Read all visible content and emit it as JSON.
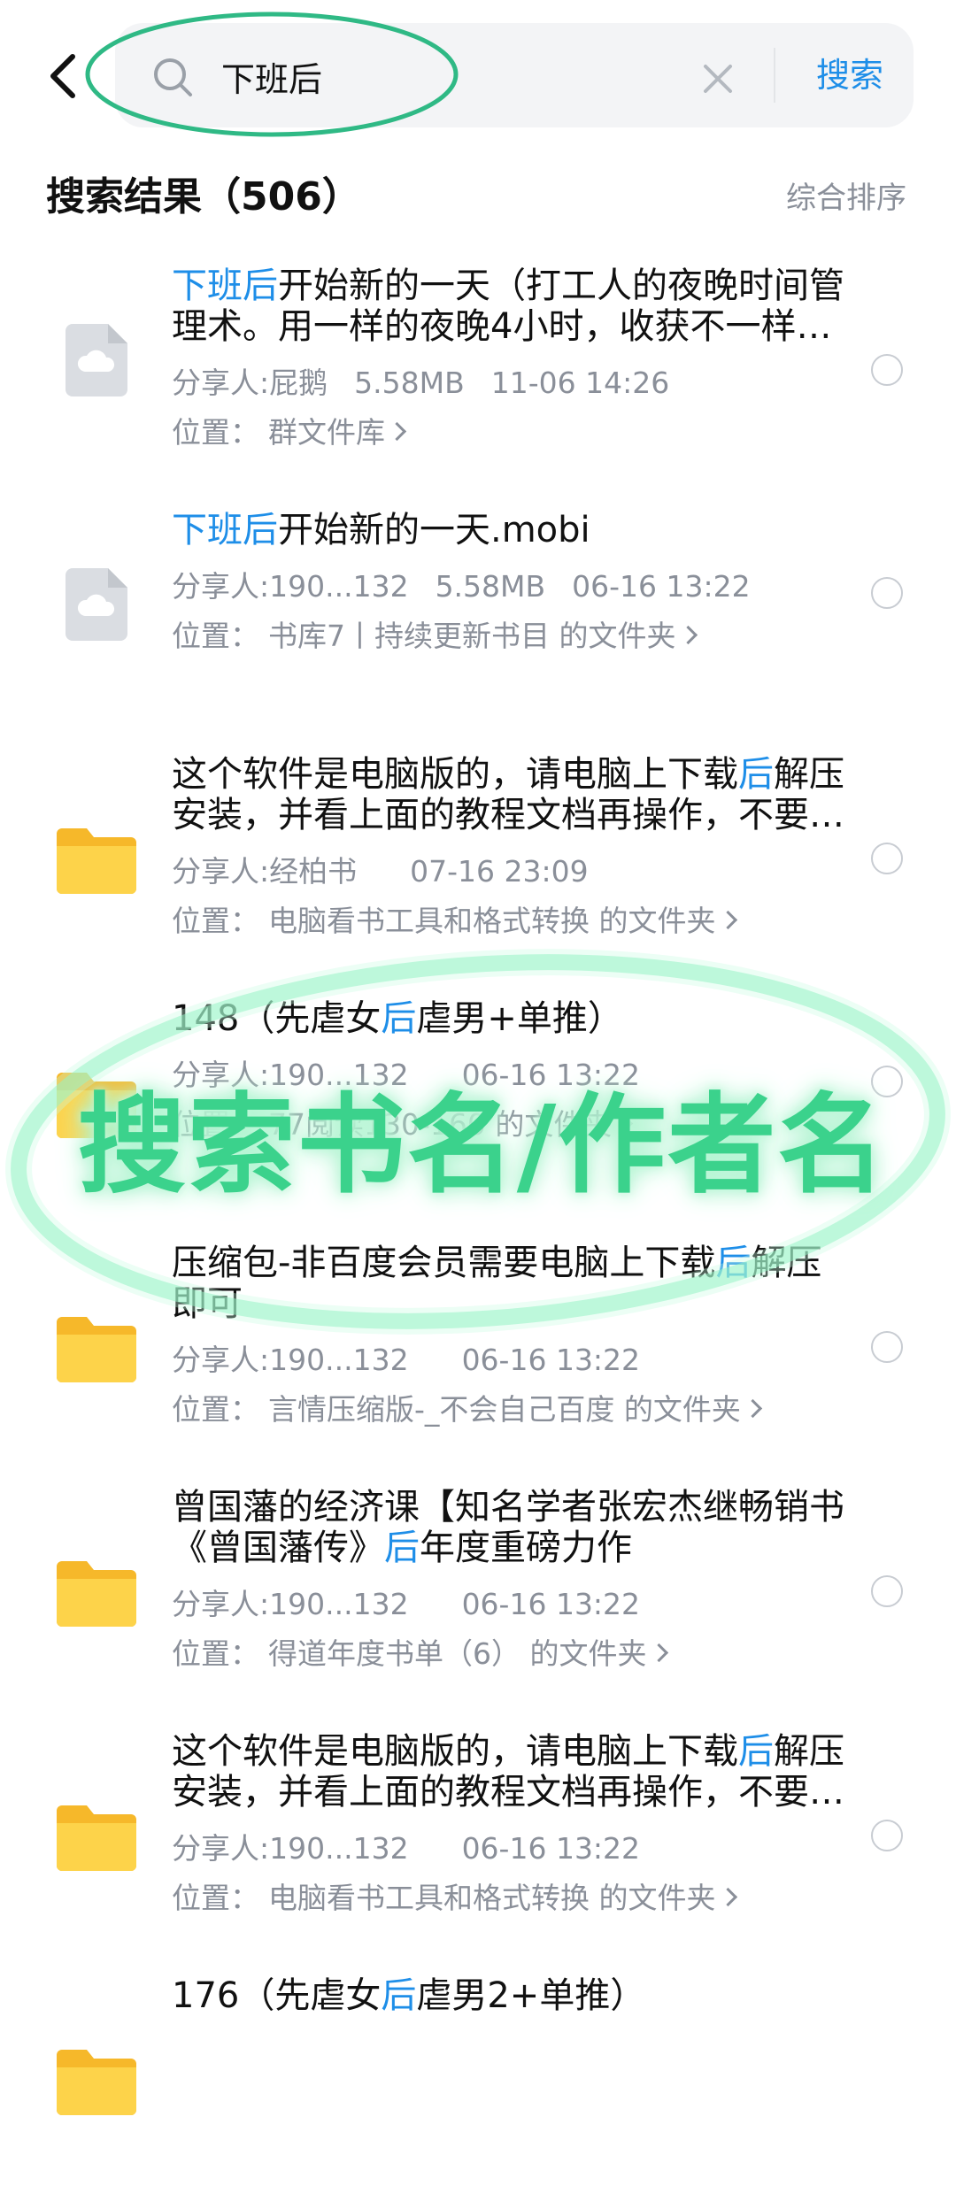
{
  "search": {
    "query": "下班后",
    "submit_label": "搜索"
  },
  "results_header": {
    "title": "搜索结果（506）",
    "sort_label": "综合排序"
  },
  "location_prefix": "位置：",
  "items": [
    {
      "type": "file",
      "title_parts": [
        {
          "t": "下班后",
          "hl": true
        },
        {
          "t": "开始新的一天（打工人的夜晚时间管理术。用一样的夜晚4小时，收获不一样…",
          "hl": false
        }
      ],
      "sharer": "分享人:屁鹅",
      "size": "5.58MB",
      "date": "11-06 14:26",
      "location": "群文件库"
    },
    {
      "type": "file",
      "title_parts": [
        {
          "t": "下班后",
          "hl": true
        },
        {
          "t": "开始新的一天.mobi",
          "hl": false
        }
      ],
      "sharer": "分享人:190...132",
      "size": "5.58MB",
      "date": "06-16 13:22",
      "location": "书库7丨持续更新书目 的文件夹"
    },
    {
      "type": "folder",
      "title_parts": [
        {
          "t": "这个软件是电脑版的，请电脑上下载",
          "hl": false
        },
        {
          "t": "后",
          "hl": true
        },
        {
          "t": "解压安装，并看上面的教程文档再操作，不要…",
          "hl": false
        }
      ],
      "sharer": "分享人:经柏书",
      "size": "",
      "date": "07-16 23:09",
      "location": "电脑看书工具和格式转换 的文件夹"
    },
    {
      "type": "folder",
      "title_parts": [
        {
          "t": "148（先虐女",
          "hl": false
        },
        {
          "t": "后",
          "hl": true
        },
        {
          "t": "虐男+单推）",
          "hl": false
        }
      ],
      "sharer": "分享人:190...132",
      "size": "",
      "date": "06-16 13:22",
      "location": "77阅读130-160 的文件夹"
    },
    {
      "type": "folder",
      "title_parts": [
        {
          "t": "压缩包-非百度会员需要电脑上下载",
          "hl": false
        },
        {
          "t": "后",
          "hl": true
        },
        {
          "t": "解压即可",
          "hl": false
        }
      ],
      "sharer": "分享人:190...132",
      "size": "",
      "date": "06-16 13:22",
      "location": "言情压缩版-_不会自己百度 的文件夹"
    },
    {
      "type": "folder",
      "title_parts": [
        {
          "t": "曾国藩的经济课【知名学者张宏杰继畅销书《曾国藩传》",
          "hl": false
        },
        {
          "t": "后",
          "hl": true
        },
        {
          "t": "年度重磅力作",
          "hl": false
        }
      ],
      "sharer": "分享人:190...132",
      "size": "",
      "date": "06-16 13:22",
      "location": "得道年度书单（6） 的文件夹"
    },
    {
      "type": "folder",
      "title_parts": [
        {
          "t": "这个软件是电脑版的，请电脑上下载",
          "hl": false
        },
        {
          "t": "后",
          "hl": true
        },
        {
          "t": "解压安装，并看上面的教程文档再操作，不要…",
          "hl": false
        }
      ],
      "sharer": "分享人:190...132",
      "size": "",
      "date": "06-16 13:22",
      "location": "电脑看书工具和格式转换 的文件夹"
    },
    {
      "type": "folder",
      "title_parts": [
        {
          "t": "176（先虐女",
          "hl": false
        },
        {
          "t": "后",
          "hl": true
        },
        {
          "t": "虐男2+单推）",
          "hl": false
        }
      ],
      "sharer": "",
      "size": "",
      "date": "",
      "location": ""
    }
  ],
  "overlay_caption": "搜索书名/作者名",
  "colors": {
    "highlight": "#1e8ee8",
    "annotation_green": "#3bd28c",
    "meta_gray": "#8a8f99"
  },
  "icons": {
    "back": "chevron-left-icon",
    "search": "search-icon",
    "clear": "close-icon",
    "file": "cloud-file-icon",
    "folder": "folder-icon",
    "select": "radio-circle-icon"
  }
}
